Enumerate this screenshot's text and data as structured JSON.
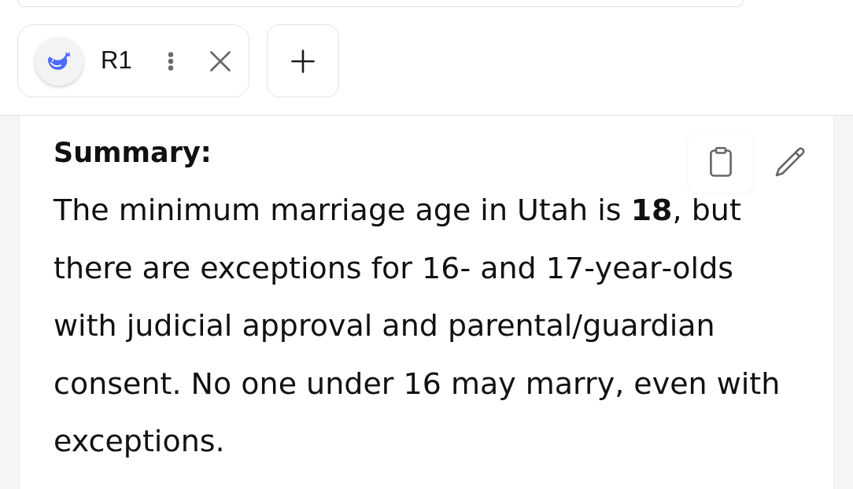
{
  "tabs": [
    {
      "label": "R1"
    }
  ],
  "message": {
    "heading": "Summary:",
    "body": "The minimum marriage age in Utah is **18**, but there are exceptions for 16‑ and 17‑year‑olds with judicial approval and parental/guardian consent. No one under 16 may marry, even with exceptions."
  }
}
